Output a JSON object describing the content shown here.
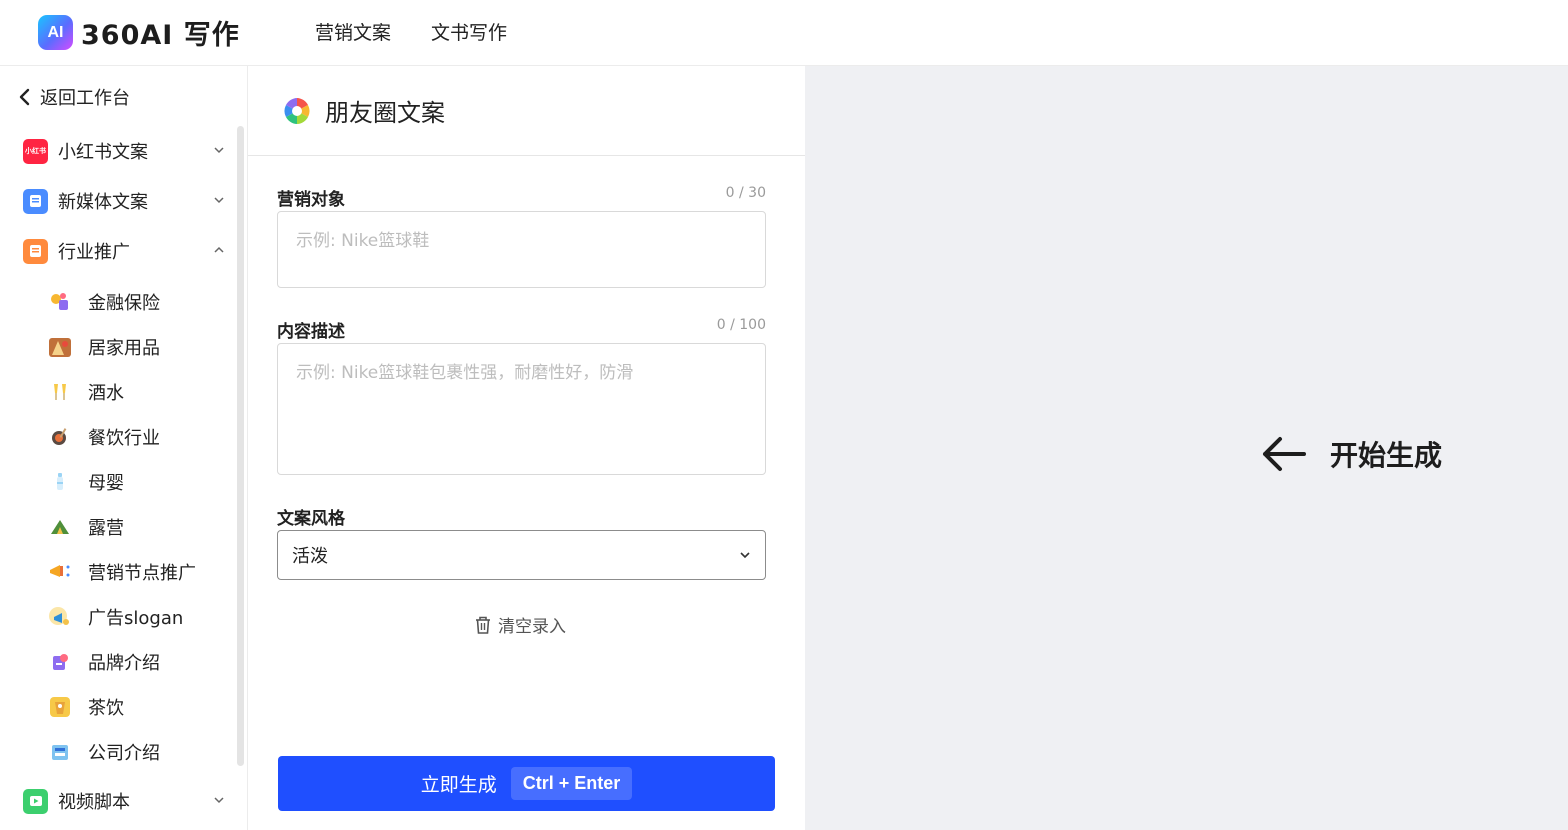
{
  "header": {
    "logo_badge": "AI",
    "logo_text": "360AI 写作",
    "nav": [
      "营销文案",
      "文书写作"
    ]
  },
  "sidebar": {
    "back_label": "返回工作台",
    "categories": [
      {
        "label": "小红书文案",
        "icon_text": "小红书",
        "color": "#ff2442",
        "expanded": false
      },
      {
        "label": "新媒体文案",
        "color": "#4a8cff",
        "expanded": false
      },
      {
        "label": "行业推广",
        "color": "#ff8a3d",
        "expanded": true
      },
      {
        "label": "视频脚本",
        "color": "#3ccf6e",
        "expanded": false
      }
    ],
    "subitems": [
      "金融保险",
      "居家用品",
      "酒水",
      "餐饮行业",
      "母婴",
      "露营",
      "营销节点推广",
      "广告slogan",
      "品牌介绍",
      "茶饮",
      "公司介绍"
    ]
  },
  "panel": {
    "title": "朋友圈文案",
    "fields": [
      {
        "label": "营销对象",
        "count": "0 / 30",
        "placeholder": "示例: Nike篮球鞋"
      },
      {
        "label": "内容描述",
        "count": "0 / 100",
        "placeholder": "示例: Nike篮球鞋包裹性强，耐磨性好，防滑"
      }
    ],
    "style_label": "文案风格",
    "style_value": "活泼",
    "clear_label": "清空录入",
    "generate_label": "立即生成",
    "shortcut": "Ctrl + Enter"
  },
  "right": {
    "hint": "开始生成"
  },
  "colors": {
    "accent": "#1f4fff",
    "right_bg": "#eff0f3"
  }
}
